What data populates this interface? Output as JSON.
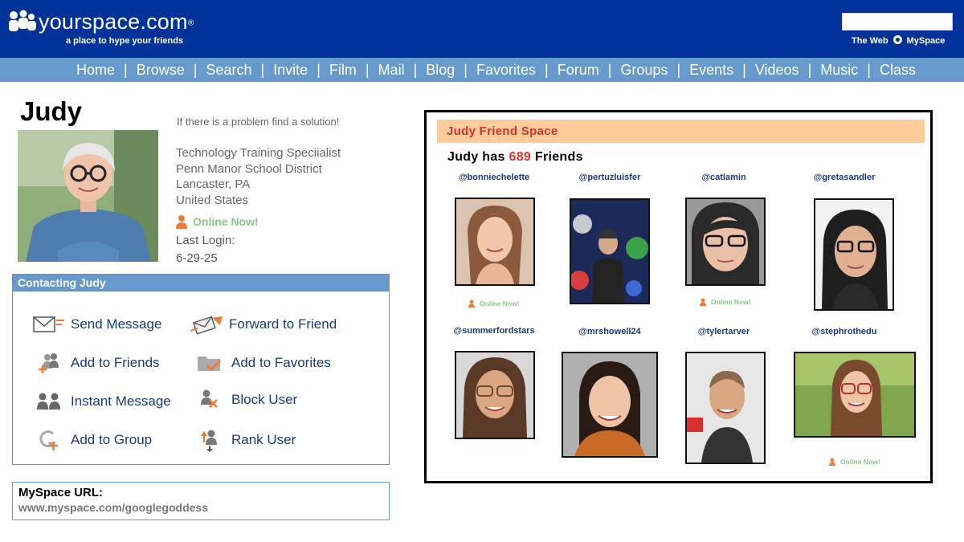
{
  "header": {
    "site_name": "yourspace.com",
    "reg_mark": "®",
    "tagline": "a place to hype your friends",
    "search_scope": {
      "web": "The Web",
      "site": "MySpace"
    }
  },
  "nav": {
    "items": [
      "Home",
      "Browse",
      "Search",
      "Invite",
      "Film",
      "Mail",
      "Blog",
      "Favorites",
      "Forum",
      "Groups",
      "Events",
      "Videos",
      "Music",
      "Class"
    ],
    "separator": "|"
  },
  "profile": {
    "name": "Judy",
    "motto": "If there is a problem find a solution!",
    "details": [
      "Technology Training Speciialist",
      "Penn Manor School District",
      "Lancaster, PA",
      "United States"
    ],
    "status": "Online Now!",
    "last_login_label": "Last Login:",
    "last_login_date": "6-29-25"
  },
  "contact": {
    "title": "Contacting Judy",
    "actions": [
      {
        "label": "Send Message",
        "icon": "envelope-icon"
      },
      {
        "label": "Forward to Friend",
        "icon": "forward-envelope-icon"
      },
      {
        "label": "Add to Friends",
        "icon": "add-friend-icon"
      },
      {
        "label": "Add to Favorites",
        "icon": "folder-check-icon"
      },
      {
        "label": "Instant Message",
        "icon": "chat-users-icon"
      },
      {
        "label": "Block User",
        "icon": "block-user-icon"
      },
      {
        "label": "Add to Group",
        "icon": "add-group-icon"
      },
      {
        "label": "Rank User",
        "icon": "rank-user-icon"
      }
    ]
  },
  "url_box": {
    "label": "MySpace URL:",
    "value": "www.myspace.com/googlegoddess"
  },
  "friend_space": {
    "title": "Judy Friend Space",
    "count_prefix": "Judy has",
    "count": "689",
    "count_suffix": "Friends",
    "online_label": "Online Now!",
    "friends": [
      {
        "handle": "@bonniechelette",
        "online": true
      },
      {
        "handle": "@pertuzluisfer",
        "online": false
      },
      {
        "handle": "@catlamin",
        "online": true
      },
      {
        "handle": "@gretasandler",
        "online": false
      },
      {
        "handle": "@summerfordstars",
        "online": false
      },
      {
        "handle": "@mrshowell24",
        "online": false
      },
      {
        "handle": "@tylertarver",
        "online": false
      },
      {
        "handle": "@stephrothedu",
        "online": true
      }
    ]
  },
  "colors": {
    "header_bg": "#003399",
    "nav_bg": "#6699cc",
    "friend_header_bg": "#ffcc99",
    "friend_header_text": "#cc3333",
    "online_green": "#8cc58c",
    "accent_orange": "#f07a30",
    "link_blue": "#1a3a80"
  }
}
